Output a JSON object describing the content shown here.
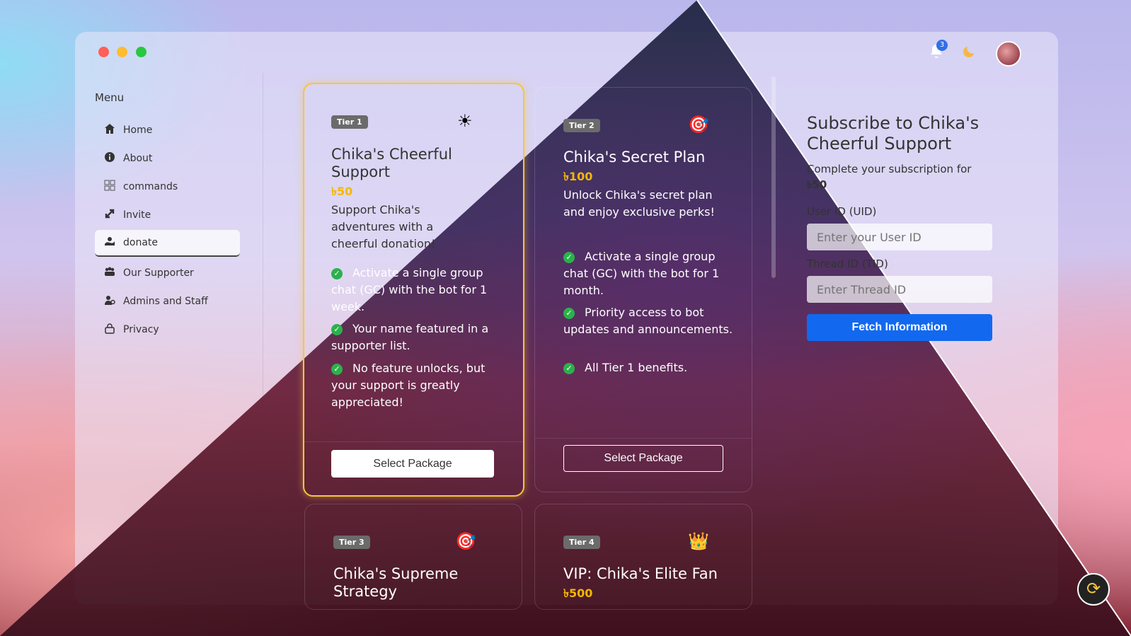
{
  "window": {
    "notification_count": "3"
  },
  "sidebar": {
    "title": "Menu",
    "items": [
      {
        "label": "Home",
        "icon": "home-icon"
      },
      {
        "label": "About",
        "icon": "info-icon"
      },
      {
        "label": "commands",
        "icon": "grid-icon"
      },
      {
        "label": "Invite",
        "icon": "link-icon"
      },
      {
        "label": "donate",
        "icon": "donate-icon"
      },
      {
        "label": "Our Supporter",
        "icon": "users-icon"
      },
      {
        "label": "Admins and Staff",
        "icon": "staff-icon"
      },
      {
        "label": "Privacy",
        "icon": "lock-icon"
      }
    ]
  },
  "cards": [
    {
      "tier": "Tier 1",
      "title": "Chika's Cheerful Support",
      "price": "৳50",
      "desc": "Support Chika's adventures with a cheerful donation!",
      "features": [
        "Activate a single group chat (GC) with the bot for 1 week.",
        "Your name featured in a supporter list.",
        "No feature unlocks, but your support is greatly appreciated!"
      ],
      "button": "Select Package",
      "emoji": "☀"
    },
    {
      "tier": "Tier 2",
      "title": "Chika's Secret Plan",
      "price": "৳100",
      "desc": "Unlock Chika's secret plan and enjoy exclusive perks!",
      "features": [
        "Activate a single group chat (GC) with the bot for 1 month.",
        "Priority access to bot updates and announcements.",
        "All Tier 1 benefits."
      ],
      "button": "Select Package",
      "emoji": "🎯"
    },
    {
      "tier": "Tier 3",
      "title": "Chika's Supreme Strategy",
      "emoji": "🎯"
    },
    {
      "tier": "Tier 4",
      "title": "VIP: Chika's Elite Fan",
      "price": "৳500",
      "emoji": "👑"
    }
  ],
  "subscribe": {
    "title": "Subscribe to Chika's Cheerful Support",
    "subtitle_prefix": "Complete your subscription for",
    "amount": "৳50",
    "uid_label": "User ID (UID)",
    "uid_placeholder": "Enter your User ID",
    "tid_label": "Thread ID (TID)",
    "tid_placeholder": "Enter Thread ID",
    "fetch_label": "Fetch Information"
  },
  "colors": {
    "accent": "#1269f0",
    "price": "#f5b700",
    "check": "#2bb14c",
    "highlight_border": "#f5c542"
  }
}
